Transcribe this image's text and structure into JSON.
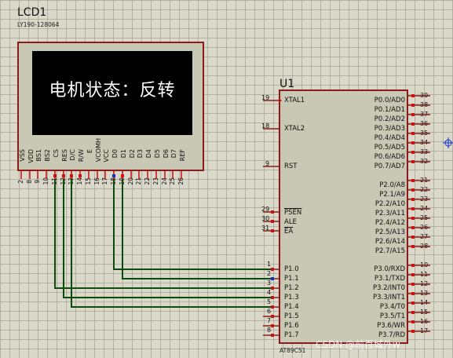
{
  "lcd": {
    "ref": "LCD1",
    "model": "LY190-128064",
    "display_text": "电机状态：反转",
    "pins": [
      {
        "label": "VSS",
        "num": "2"
      },
      {
        "label": "VDD",
        "num": "8"
      },
      {
        "label": "BS1",
        "num": "9"
      },
      {
        "label": "BS2",
        "num": "10"
      },
      {
        "label": "CS",
        "num": "11"
      },
      {
        "label": "RES",
        "num": "12"
      },
      {
        "label": "D/C",
        "num": "13"
      },
      {
        "label": "R/W",
        "num": "14"
      },
      {
        "label": "E",
        "num": "15"
      },
      {
        "label": "VCOMH",
        "num": "16"
      },
      {
        "label": "VCC",
        "num": "17"
      },
      {
        "label": "D0",
        "num": "18"
      },
      {
        "label": "D1",
        "num": "19"
      },
      {
        "label": "D2",
        "num": "20"
      },
      {
        "label": "D3",
        "num": "21"
      },
      {
        "label": "D4",
        "num": "22"
      },
      {
        "label": "D5",
        "num": "23"
      },
      {
        "label": "D6",
        "num": "24"
      },
      {
        "label": "D7",
        "num": "25"
      },
      {
        "label": "REF",
        "num": "26"
      }
    ]
  },
  "mcu": {
    "ref": "U1",
    "part": "AT89C51",
    "left_pins": [
      {
        "num": "19",
        "label": "XTAL1"
      },
      {
        "num": "18",
        "label": "XTAL2"
      },
      {
        "num": "9",
        "label": "RST"
      },
      {
        "num": "29",
        "label": "PSEN"
      },
      {
        "num": "30",
        "label": "ALE"
      },
      {
        "num": "31",
        "label": "EA"
      },
      {
        "num": "1",
        "label": "P1.0"
      },
      {
        "num": "2",
        "label": "P1.1"
      },
      {
        "num": "3",
        "label": "P1.2"
      },
      {
        "num": "4",
        "label": "P1.3"
      },
      {
        "num": "5",
        "label": "P1.4"
      },
      {
        "num": "6",
        "label": "P1.5"
      },
      {
        "num": "7",
        "label": "P1.6"
      },
      {
        "num": "8",
        "label": "P1.7"
      }
    ],
    "right_pins": [
      {
        "num": "39",
        "label": "P0.0/AD0"
      },
      {
        "num": "38",
        "label": "P0.1/AD1"
      },
      {
        "num": "37",
        "label": "P0.2/AD2"
      },
      {
        "num": "36",
        "label": "P0.3/AD3"
      },
      {
        "num": "35",
        "label": "P0.4/AD4"
      },
      {
        "num": "34",
        "label": "P0.5/AD5"
      },
      {
        "num": "33",
        "label": "P0.6/AD6"
      },
      {
        "num": "32",
        "label": "P0.7/AD7"
      },
      {
        "num": "21",
        "label": "P2.0/A8"
      },
      {
        "num": "22",
        "label": "P2.1/A9"
      },
      {
        "num": "23",
        "label": "P2.2/A10"
      },
      {
        "num": "24",
        "label": "P2.3/A11"
      },
      {
        "num": "25",
        "label": "P2.4/A12"
      },
      {
        "num": "26",
        "label": "P2.5/A13"
      },
      {
        "num": "27",
        "label": "P2.6/A14"
      },
      {
        "num": "28",
        "label": "P2.7/A15"
      },
      {
        "num": "10",
        "label": "P3.0/RXD"
      },
      {
        "num": "11",
        "label": "P3.1/TXD"
      },
      {
        "num": "12",
        "label": "P3.2/INT0"
      },
      {
        "num": "13",
        "label": "P3.3/INT1"
      },
      {
        "num": "14",
        "label": "P3.4/T0"
      },
      {
        "num": "15",
        "label": "P3.5/T1"
      },
      {
        "num": "16",
        "label": "P3.6/WR"
      },
      {
        "num": "17",
        "label": "P3.7/RD"
      }
    ]
  },
  "watermark": "CSDN @前百城外w",
  "colors": {
    "grid_bg": "#d9d8c9",
    "component_outline": "#8b1a1a",
    "component_fill": "#c8c8b4",
    "lcd_screen": "#000000",
    "wire": "#0d4a0d",
    "pin_red": "#cc1111",
    "pin_blue": "#1133cc"
  }
}
